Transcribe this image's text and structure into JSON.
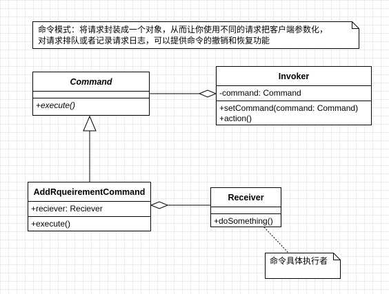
{
  "note_top": {
    "text": "命令模式：将请求封装成一个对象，从而让你使用不同的请求把客户端参数化，\n对请求排队或者记录请求日志，可以提供命令的撤销和恢复功能"
  },
  "classes": {
    "command": {
      "name": "Command",
      "operations": [
        "+execute()"
      ]
    },
    "invoker": {
      "name": "Invoker",
      "attributes": [
        "-command: Command"
      ],
      "operations": [
        "+setCommand(command: Command)",
        "+action()"
      ]
    },
    "add_requirement_command": {
      "name": "AddRqueirementCommand",
      "attributes": [
        "+reciever: Reciever"
      ],
      "operations": [
        "+execute()"
      ]
    },
    "receiver": {
      "name": "Receiver",
      "operations": [
        "+doSomething()"
      ]
    }
  },
  "note_receiver": {
    "text": "命令具体执行者"
  },
  "colors": {
    "line": "#000000",
    "grid": "#ececec",
    "background": "#ffffff"
  }
}
